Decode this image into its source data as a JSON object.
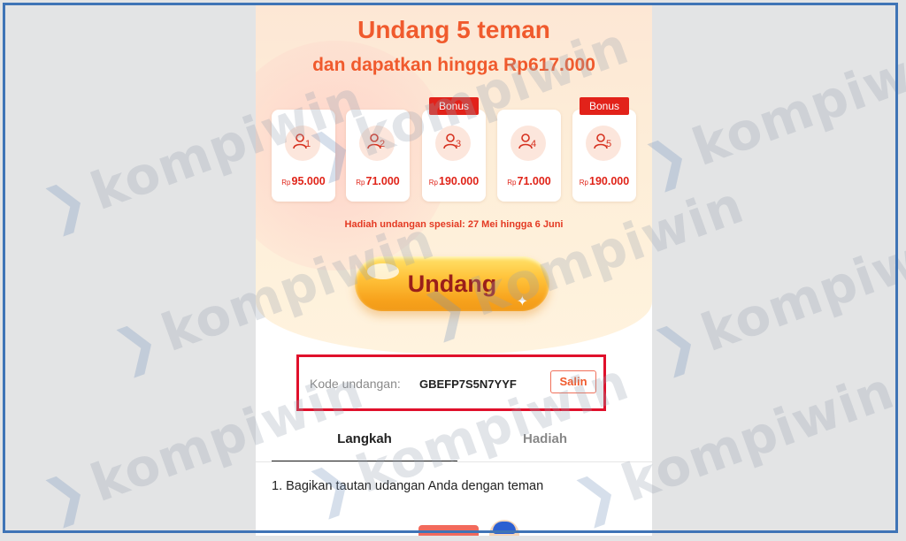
{
  "header": {
    "title": "Undang 5 teman",
    "subtitle": "dan dapatkan hingga Rp617.000"
  },
  "rewards": [
    {
      "num": "1",
      "currency": "Rp",
      "amount": "95.000",
      "bonus": ""
    },
    {
      "num": "2",
      "currency": "Rp",
      "amount": "71.000",
      "bonus": ""
    },
    {
      "num": "3",
      "currency": "Rp",
      "amount": "190.000",
      "bonus": "Bonus"
    },
    {
      "num": "4",
      "currency": "Rp",
      "amount": "71.000",
      "bonus": ""
    },
    {
      "num": "5",
      "currency": "Rp",
      "amount": "190.000",
      "bonus": "Bonus"
    }
  ],
  "special_note": "Hadiah undangan spesial: 27 Mei hingga 6 Juni",
  "invite_button": "Undang",
  "invite_code": {
    "label": "Kode undangan:",
    "value": "GBEFP7S5N7YYF",
    "copy_label": "Salin"
  },
  "tabs": [
    {
      "label": "Langkah",
      "active": true
    },
    {
      "label": "Hadiah",
      "active": false
    }
  ],
  "steps": [
    "1. Bagikan tautan udangan Anda dengan teman"
  ],
  "watermark": "kompiwin",
  "colors": {
    "accent": "#f05a2d",
    "amount": "#e02419",
    "bonus_bg": "#e2221a",
    "highlight_border": "#e0102b",
    "frame_border": "#3f74b6"
  }
}
